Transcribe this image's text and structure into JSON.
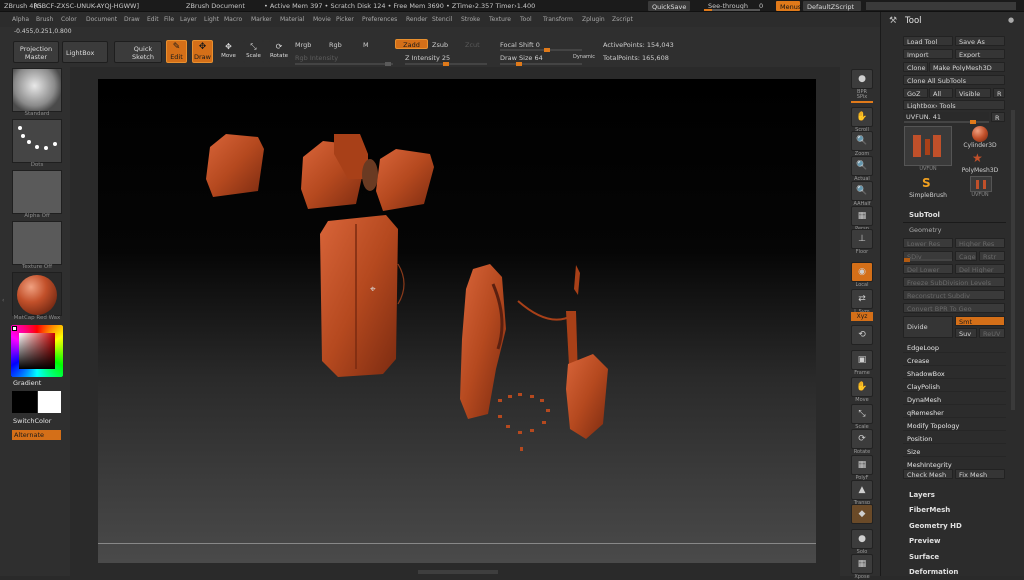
{
  "titlebar": {
    "app": "ZBrush 4R5",
    "key": "[GBCF-ZXSC-UNUK-AYQJ-HGWW]",
    "doc": "ZBrush Document",
    "stats": "• Active Mem 397 • Scratch Disk 124 • Free Mem 3690 • ZTime›2.357 Timer›1.400",
    "quicksave": "QuickSave",
    "seethrough": "See-through",
    "seethrough_val": "0",
    "menus": "Menus",
    "script": "DefaultZScript"
  },
  "menubar": [
    "Alpha",
    "Brush",
    "Color",
    "Document",
    "Draw",
    "Edit",
    "File",
    "Layer",
    "Light",
    "Macro",
    "Marker",
    "Material",
    "Movie",
    "Picker",
    "Preferences",
    "Render",
    "Stencil",
    "Stroke",
    "Texture",
    "Tool",
    "Transform",
    "Zplugin",
    "Zscript"
  ],
  "coords": "-0.455,0.251,0.800",
  "shelf": {
    "projection": "Projection",
    "master": "Master",
    "lightbox": "LightBox",
    "quick": "Quick",
    "sketch": "Sketch",
    "edit": "Edit",
    "draw": "Draw",
    "move": "Move",
    "scale": "Scale",
    "rotate": "Rotate",
    "mrgb": "Mrgb",
    "rgb": "Rgb",
    "m": "M",
    "zadd": "Zadd",
    "zsub": "Zsub",
    "zcut": "Zcut",
    "rgb_intensity": "Rgb Intensity",
    "z_intensity": "Z Intensity 25",
    "focal_shift": "Focal Shift 0",
    "draw_size": "Draw Size 64",
    "dynamic": "Dynamic",
    "active_points": "ActivePoints: 154,043",
    "total_points": "TotalPoints: 165,608"
  },
  "left": {
    "brush_cap": "Standard",
    "stroke_cap": "Dots",
    "alpha_cap": "Alpha Off",
    "texture_cap": "Texture Off",
    "material_cap": "MatCap Red Wax",
    "gradient": "Gradient",
    "switchcolor": "SwitchColor",
    "alternate": "Alternate"
  },
  "right": [
    {
      "label": "BPR",
      "glyph": "●"
    },
    {
      "label": "SPix",
      "glyph": ""
    },
    {
      "label": "Scroll",
      "glyph": "✋"
    },
    {
      "label": "Zoom",
      "glyph": "🔍"
    },
    {
      "label": "Actual",
      "glyph": "🔍"
    },
    {
      "label": "AAHalf",
      "glyph": "🔍"
    },
    {
      "label": "Persp",
      "glyph": "▦"
    },
    {
      "label": "Floor",
      "glyph": "⊥"
    },
    {
      "label": "Local",
      "glyph": "◉"
    },
    {
      "label": "L.Sym",
      "glyph": "⇄"
    },
    {
      "label": "Xyz",
      "glyph": ""
    },
    {
      "label": "",
      "glyph": "⟲"
    },
    {
      "label": "Frame",
      "glyph": "▣"
    },
    {
      "label": "Move",
      "glyph": "✋"
    },
    {
      "label": "Scale",
      "glyph": "⤡"
    },
    {
      "label": "Rotate",
      "glyph": "⟳"
    },
    {
      "label": "PolyF",
      "glyph": "▦"
    },
    {
      "label": "Transp",
      "glyph": "▲"
    },
    {
      "label": "",
      "glyph": "◆"
    },
    {
      "label": "Solo",
      "glyph": "●"
    },
    {
      "label": "Xpose",
      "glyph": "▦"
    }
  ],
  "tool": {
    "title": "Tool",
    "load": "Load Tool",
    "saveas": "Save As",
    "import": "Import",
    "export": "Export",
    "clone": "Clone",
    "make_polymesh": "Make PolyMesh3D",
    "clone_all": "Clone All SubTools",
    "goz": "GoZ",
    "all": "All",
    "visible": "Visible",
    "r": "R",
    "lightbox_tools": "Lightbox› Tools",
    "uvfun_label": "UVFUN. 41",
    "current_tool": "UVFUN",
    "cylinder": "Cylinder3D",
    "polymesh": "PolyMesh3D",
    "simplebrush": "SimpleBrush",
    "uvfun_small": "UVFUN",
    "subtool": "SubTool",
    "geometry": "Geometry",
    "lower_res": "Lower Res",
    "higher_res": "Higher Res",
    "sdiv": "SDiv",
    "cage": "Cage",
    "rstr": "Rstr",
    "del_lower": "Del Lower",
    "del_higher": "Del Higher",
    "freeze": "Freeze SubDivision Levels",
    "reconstruct": "Reconstruct Subdiv",
    "convert_bpr": "Convert BPR To Geo",
    "divide": "Divide",
    "smt": "Smt",
    "suv": "Suv",
    "reuv": "ReUV",
    "geo_items": [
      "EdgeLoop",
      "Crease",
      "ShadowBox",
      "ClayPolish",
      "DynaMesh",
      "qRemesher",
      "Modify Topology",
      "Position",
      "Size",
      "MeshIntegrity"
    ],
    "check_mesh": "Check Mesh",
    "fix_mesh": "Fix Mesh",
    "sections": [
      "Layers",
      "FiberMesh",
      "Geometry HD",
      "Preview",
      "Surface",
      "Deformation"
    ]
  },
  "colors": {
    "accent": "#e07a1a",
    "clay": "#b5491f"
  }
}
